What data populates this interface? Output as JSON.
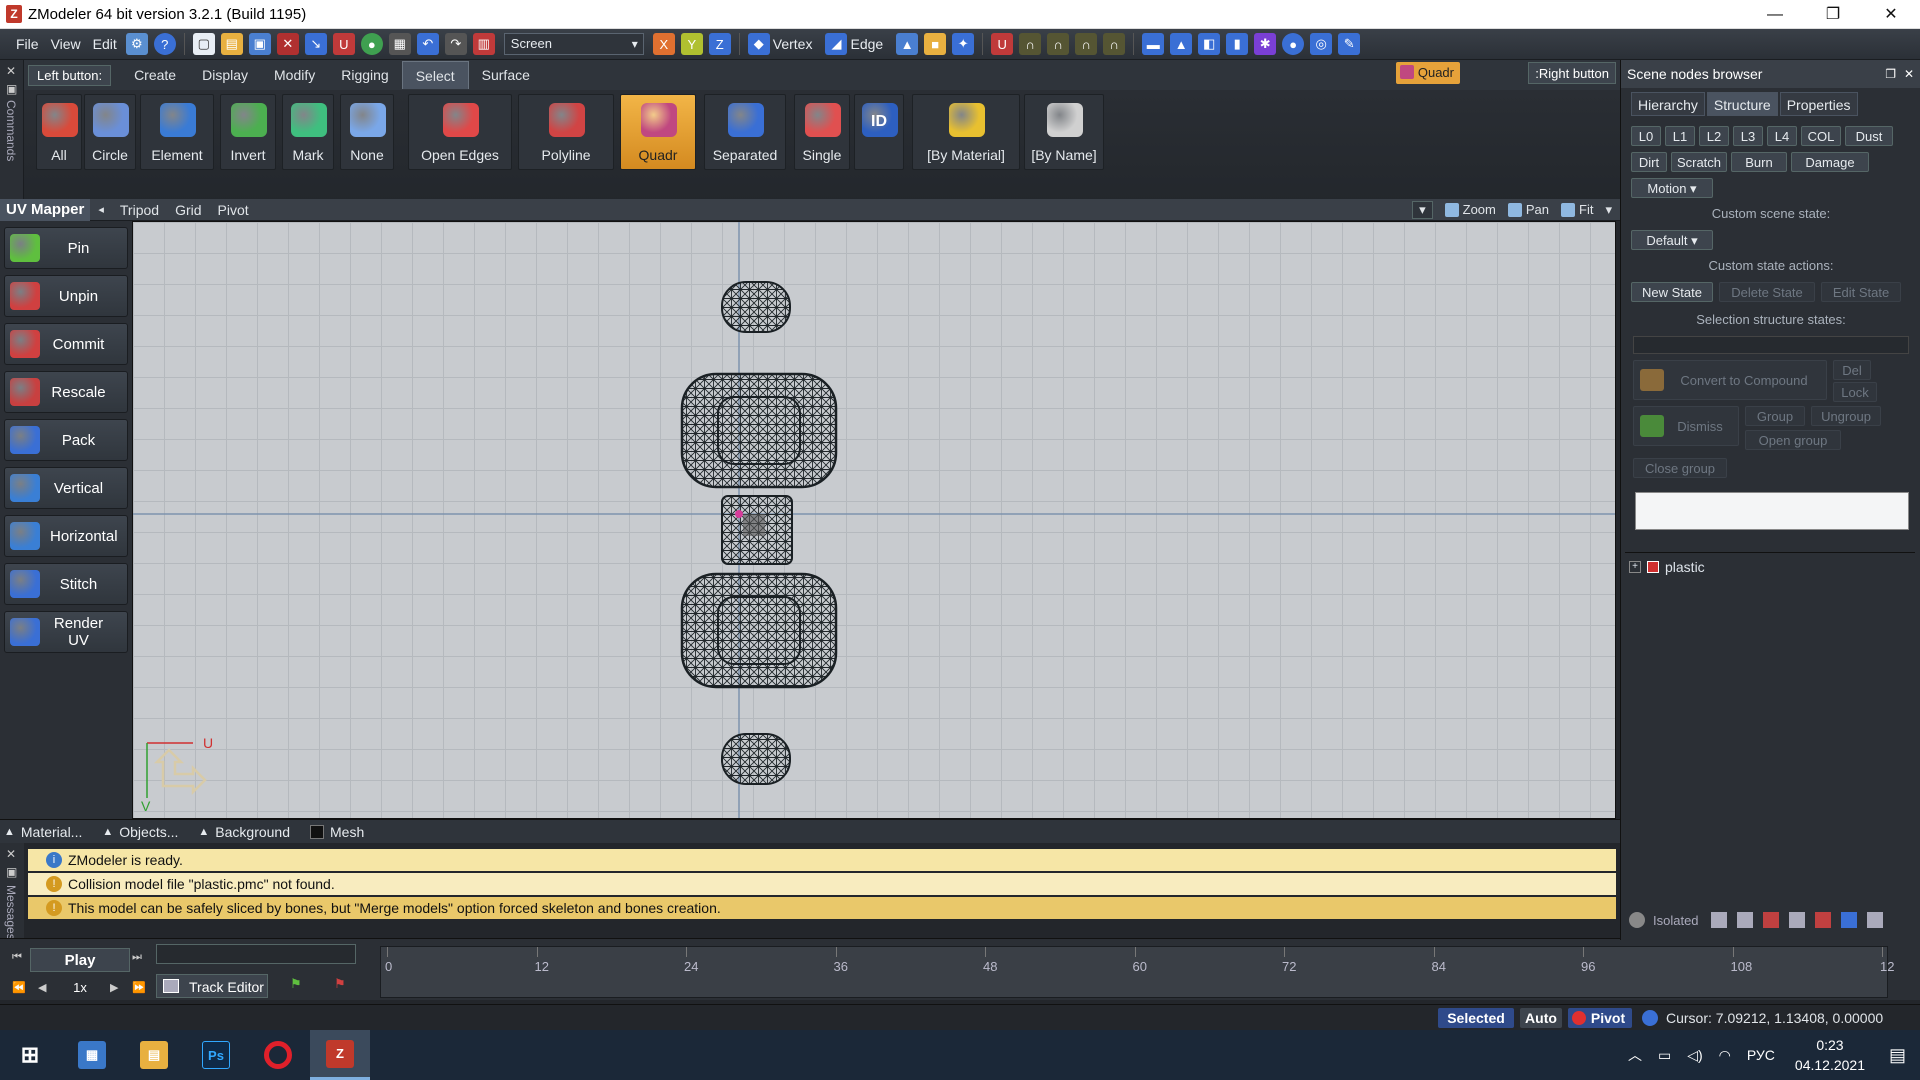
{
  "window": {
    "title": "ZModeler 64 bit version 3.2.1 (Build 1195)",
    "min": "—",
    "max": "❐",
    "close": "✕"
  },
  "menu": [
    "File",
    "View",
    "Edit"
  ],
  "toolbar": {
    "screen_value": "Screen",
    "vertex": "Vertex",
    "edge": "Edge"
  },
  "commands_label": "Commands",
  "tabs": {
    "left_button": "Left button:",
    "items": [
      "Create",
      "Display",
      "Modify",
      "Rigging",
      "Select",
      "Surface"
    ],
    "active": "Select",
    "mode_badge": "Quadr",
    "right_button": ":Right button"
  },
  "ribbon": [
    {
      "label": "All",
      "color": "#d94a3a"
    },
    {
      "label": "Circle",
      "color": "#6a8fd8"
    },
    {
      "label": "Element",
      "color": "#3a7bd5"
    },
    {
      "label": "Invert",
      "color": "#4caf50"
    },
    {
      "label": "Mark",
      "color": "#3fbf7f"
    },
    {
      "label": "None",
      "color": "#7aa7e8"
    },
    {
      "label": "Open Edges",
      "color": "#e04848"
    },
    {
      "label": "Polyline",
      "color": "#d14444"
    },
    {
      "label": "Quadr",
      "color": "#c04880"
    },
    {
      "label": "Separated",
      "color": "#3a6fd5"
    },
    {
      "label": "Single",
      "color": "#e05050"
    },
    {
      "label": "ID",
      "color": "#2d5fc0"
    },
    {
      "label": "[By Material]",
      "color": "#e8c030"
    },
    {
      "label": "[By Name]",
      "color": "#d0d0d0"
    }
  ],
  "uvmapper": {
    "title": "UV Mapper",
    "links": [
      "Tripod",
      "Grid",
      "Pivot"
    ],
    "view_buttons": [
      "Zoom",
      "Pan",
      "Fit"
    ]
  },
  "leftpanel": [
    {
      "label": "Pin",
      "color": "#5fbf3f"
    },
    {
      "label": "Unpin",
      "color": "#d04040"
    },
    {
      "label": "Commit",
      "color": "#d04040"
    },
    {
      "label": "Rescale",
      "color": "#c84040"
    },
    {
      "label": "Pack",
      "color": "#3a6fd5"
    },
    {
      "label": "Vertical",
      "color": "#3a7fd5"
    },
    {
      "label": "Horizontal",
      "color": "#3a7fd5"
    },
    {
      "label": "Stitch",
      "color": "#3a6fd5"
    },
    {
      "label": "Render UV",
      "color": "#3a6fd5"
    }
  ],
  "axis": {
    "u": "U",
    "v": "V"
  },
  "bottomtabs": [
    "Material...",
    "Objects...",
    "Background",
    "Mesh"
  ],
  "messages_label": "Messages",
  "messages": [
    {
      "type": "info",
      "text": "ZModeler is ready."
    },
    {
      "type": "warn",
      "text": "Collision model file \"plastic.pmc\" not found."
    },
    {
      "type": "warn",
      "text": "This model can be safely sliced by bones, but \"Merge models\" option forced skeleton and bones creation."
    }
  ],
  "timeline": {
    "play": "Play",
    "speed": "1x",
    "track_editor": "Track Editor",
    "ticks": [
      "0",
      "12",
      "24",
      "36",
      "48",
      "60",
      "72",
      "84",
      "96",
      "108",
      "12"
    ]
  },
  "statusbar": {
    "selected": "Selected",
    "auto": "Auto",
    "pivot": "Pivot",
    "cursor": "Cursor: 7.09212, 1.13408, 0.00000"
  },
  "rightpanel": {
    "title": "Scene nodes browser",
    "tabs": [
      "Hierarchy",
      "Structure",
      "Properties"
    ],
    "active_tab": "Structure",
    "state_buttons_row1": [
      "L0",
      "L1",
      "L2",
      "L3",
      "L4",
      "COL",
      "Dust"
    ],
    "state_buttons_row2": [
      "Dirt",
      "Scratch",
      "Burn",
      "Damage"
    ],
    "motion": "Motion",
    "custom_scene_state": "Custom scene state:",
    "default_value": "Default",
    "custom_state_actions": "Custom state actions:",
    "new_state": "New State",
    "delete_state": "Delete State",
    "edit_state": "Edit State",
    "selection_structure_states": "Selection structure states:",
    "convert_to_compound": "Convert to Compound",
    "del": "Del",
    "lock": "Lock",
    "dismiss": "Dismiss",
    "group": "Group",
    "ungroup": "Ungroup",
    "open_group": "Open group",
    "close_group": "Close group",
    "tree_item": "plastic",
    "isolated": "Isolated"
  },
  "taskbar": {
    "lang": "РУС",
    "time": "0:23",
    "date": "04.12.2021"
  }
}
